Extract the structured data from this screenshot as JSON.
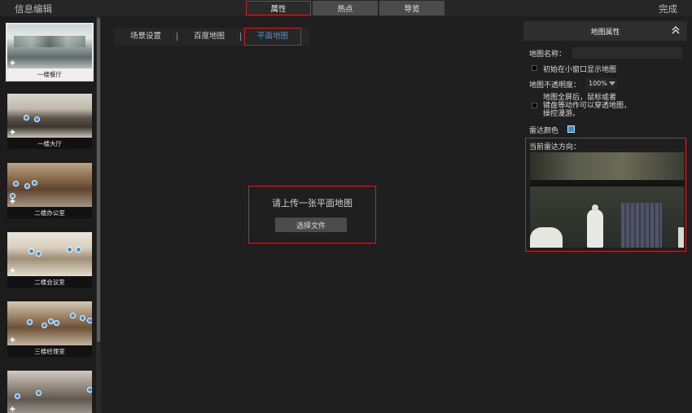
{
  "header": {
    "title": "信息编辑",
    "done_label": "完成",
    "tabs": [
      "属性",
      "热点",
      "导览"
    ]
  },
  "scenes": [
    {
      "label": "一楼餐厅"
    },
    {
      "label": "一楼大厅"
    },
    {
      "label": "二楼办公室"
    },
    {
      "label": "二楼会议室"
    },
    {
      "label": "三楼经理室"
    },
    {
      "label": ""
    }
  ],
  "subtabs": [
    "场景设置",
    "百度地图",
    "平面地图"
  ],
  "upload": {
    "prompt": "请上传一张平面地图",
    "button": "选择文件"
  },
  "map_props": {
    "title": "地图属性",
    "name_label": "地图名称：",
    "name_value": "",
    "show_small_window_label": "初始在小窗口显示地图",
    "opacity_label": "地图不透明度：",
    "opacity_value": "100%",
    "fullscreen_line1": "地图全屏后，鼠标或者",
    "fullscreen_line2": "键盘等动作可以穿透地图，",
    "fullscreen_line3": "操控漫游。",
    "radar_color_label": "雷达颜色",
    "radar_color": "#2c8fe0",
    "radar_direction_label": "当前雷达方向："
  },
  "colors": {
    "accent": "#3d98e8",
    "highlight_border": "#c6242b"
  }
}
